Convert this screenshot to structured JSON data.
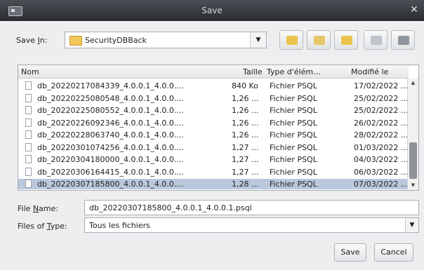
{
  "window": {
    "title": "Save"
  },
  "save_in": {
    "label_pre": "Save ",
    "label_mnemonic": "I",
    "label_post": "n:",
    "folder": "SecurityDBBack"
  },
  "toolbar": {
    "buttons": [
      {
        "name": "up-folder-button",
        "icon": "folder-up-icon",
        "color": "#e9c44d"
      },
      {
        "name": "home-button",
        "icon": "home-icon",
        "color": "#e7c66a"
      },
      {
        "name": "new-folder-button",
        "icon": "new-folder-icon",
        "color": "#e9c44d"
      },
      {
        "name": "list-view-button",
        "icon": "list-view-icon",
        "color": "#bfc4ca"
      },
      {
        "name": "details-view-button",
        "icon": "details-view-icon",
        "color": "#8f959c"
      }
    ]
  },
  "columns": {
    "name": "Nom",
    "size": "Taille",
    "type": "Type d'élém...",
    "date": "Modifié le"
  },
  "files": [
    {
      "name": "db_20220217084339_4.0.0.1_4.0.0....",
      "size": "840 Ko",
      "type": "Fichier PSQL",
      "date": "17/02/2022 ..."
    },
    {
      "name": "db_20220225080548_4.0.0.1_4.0.0....",
      "size": "1,26 ...",
      "type": "Fichier PSQL",
      "date": "25/02/2022 ..."
    },
    {
      "name": "db_20220225080552_4.0.0.1_4.0.0....",
      "size": "1,26 ...",
      "type": "Fichier PSQL",
      "date": "25/02/2022 ..."
    },
    {
      "name": "db_20220226092346_4.0.0.1_4.0.0....",
      "size": "1,26 ...",
      "type": "Fichier PSQL",
      "date": "26/02/2022 ..."
    },
    {
      "name": "db_20220228063740_4.0.0.1_4.0.0....",
      "size": "1,26 ...",
      "type": "Fichier PSQL",
      "date": "28/02/2022 ..."
    },
    {
      "name": "db_20220301074256_4.0.0.1_4.0.0....",
      "size": "1,27 ...",
      "type": "Fichier PSQL",
      "date": "01/03/2022 ..."
    },
    {
      "name": "db_20220304180000_4.0.0.1_4.0.0....",
      "size": "1,27 ...",
      "type": "Fichier PSQL",
      "date": "04/03/2022 ..."
    },
    {
      "name": "db_20220306164415_4.0.0.1_4.0.0....",
      "size": "1,27 ...",
      "type": "Fichier PSQL",
      "date": "06/03/2022 ..."
    },
    {
      "name": "db_20220307185800_4.0.0.1_4.0.0....",
      "size": "1,28 ...",
      "type": "Fichier PSQL",
      "date": "07/03/2022 ...",
      "selected": true
    }
  ],
  "file_name": {
    "label_pre": "File ",
    "label_mnemonic": "N",
    "label_post": "ame:",
    "value": "db_20220307185800_4.0.0.1_4.0.0.1.psql"
  },
  "file_type": {
    "label_pre": "Files of ",
    "label_mnemonic": "T",
    "label_post": "ype:",
    "value": "Tous les fichiers"
  },
  "buttons": {
    "save": "Save",
    "cancel": "Cancel"
  },
  "colors": {
    "selection": "#b9c8dc",
    "titlebar": "#2a2c31",
    "dialog": "#eceeef"
  }
}
